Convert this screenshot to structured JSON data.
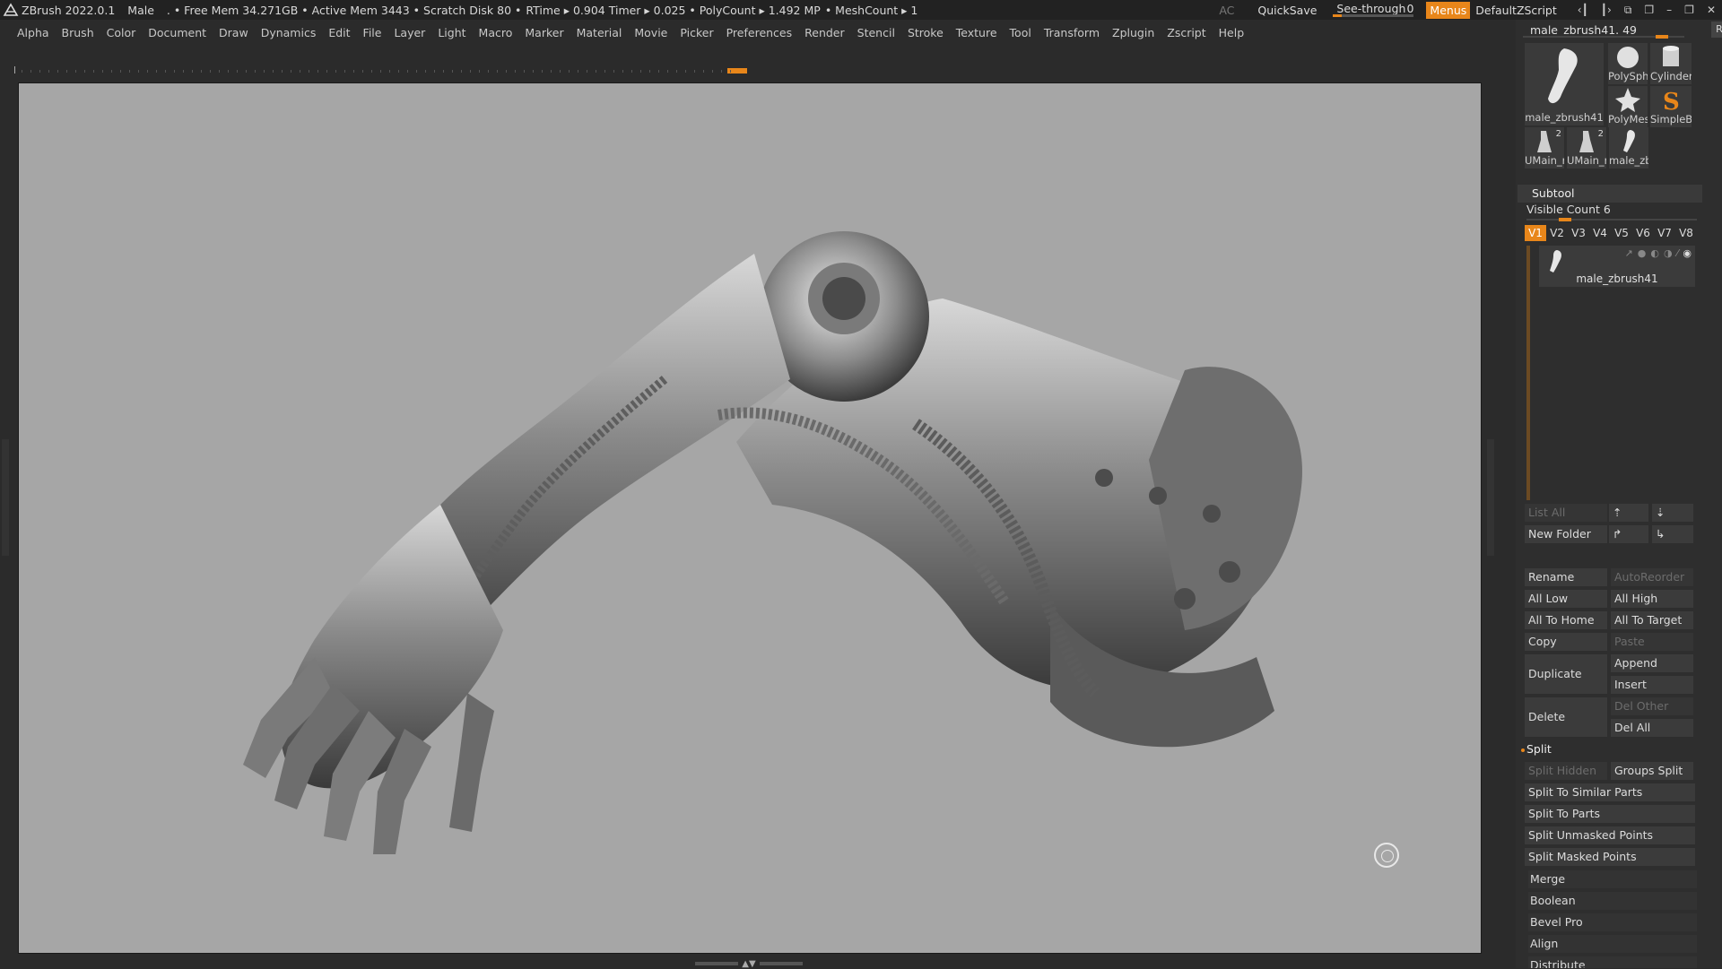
{
  "titlebar": {
    "app": "ZBrush 2022.0.1",
    "project": "Male",
    "stats": [
      ". • Free Mem 34.271GB • Active Mem 3443 • Scratch Disk 80 •",
      "RTime ▸ 0.904 Timer ▸ 0.025 • PolyCount ▸ 1.492 MP",
      "• MeshCount ▸ 1"
    ],
    "ac": "AC",
    "quicksave": "QuickSave",
    "see_through_label": "See-through",
    "see_through_value": "0",
    "menus": "Menus",
    "default_zscript": "DefaultZScript"
  },
  "menubar": [
    "Alpha",
    "Brush",
    "Color",
    "Document",
    "Draw",
    "Dynamics",
    "Edit",
    "File",
    "Layer",
    "Light",
    "Macro",
    "Marker",
    "Material",
    "Movie",
    "Picker",
    "Preferences",
    "Render",
    "Stencil",
    "Stroke",
    "Texture",
    "Tool",
    "Transform",
    "Zplugin",
    "Zscript",
    "Help"
  ],
  "tool": {
    "current_name": "male_zbrush41. 49",
    "r_button": "R",
    "thumbs": [
      {
        "label": "male_zbrush41"
      },
      {
        "label": "PolySph"
      },
      {
        "label": "Cylinder"
      },
      {
        "label": "PolyMes"
      },
      {
        "label": "SimpleB"
      },
      {
        "label": "UMain_r",
        "badge": "2"
      },
      {
        "label": "UMain_r",
        "badge": "2"
      },
      {
        "label": "male_zb"
      }
    ]
  },
  "subtool": {
    "title": "Subtool",
    "visible_count": "Visible Count 6",
    "vtabs": [
      "V1",
      "V2",
      "V3",
      "V4",
      "V5",
      "V6",
      "V7",
      "V8"
    ],
    "item_name": "male_zbrush41",
    "buttons": {
      "list_all": "List All",
      "new_folder": "New Folder",
      "rename": "Rename",
      "auto_reorder": "AutoReorder",
      "all_low": "All Low",
      "all_high": "All High",
      "all_to_home": "All To Home",
      "all_to_target": "All To Target",
      "copy": "Copy",
      "paste": "Paste",
      "duplicate": "Duplicate",
      "append": "Append",
      "insert": "Insert",
      "delete": "Delete",
      "del_other": "Del Other",
      "del_all": "Del All"
    },
    "split": {
      "title": "Split",
      "split_hidden": "Split Hidden",
      "groups_split": "Groups Split",
      "to_similar": "Split To Similar Parts",
      "to_parts": "Split To Parts",
      "unmasked": "Split Unmasked Points",
      "masked": "Split Masked Points"
    },
    "sections": [
      "Merge",
      "Boolean",
      "Bevel Pro",
      "Align",
      "Distribute"
    ]
  },
  "colors": {
    "accent": "#e8861a",
    "viewport_bg": "#a6a6a6",
    "panel_bg": "#2e2e2e"
  }
}
